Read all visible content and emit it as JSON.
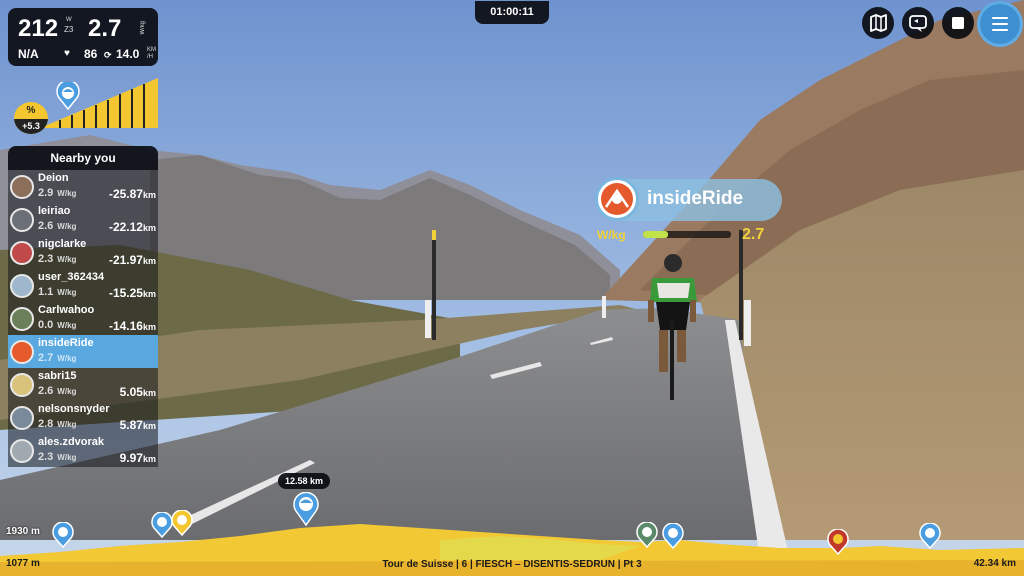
{
  "stats": {
    "power": "212",
    "power_unit": "W",
    "zone": "Z3",
    "wkg": "2.7",
    "wkg_unit": "W/kg",
    "heart_rate": "N/A",
    "cadence": "86",
    "speed": "14.0",
    "speed_unit_top": "KM",
    "speed_unit_bot": "/H"
  },
  "grade": {
    "label": "%",
    "value": "+5.3"
  },
  "timer": "01:00:11",
  "nearby": {
    "title": "Nearby you",
    "wkg_unit": "W/kg",
    "dist_unit": "km",
    "riders": [
      {
        "name": "Deion",
        "wkg": "2.9",
        "dist": "-25.87",
        "active": false
      },
      {
        "name": "leiriao",
        "wkg": "2.6",
        "dist": "-22.12",
        "active": false
      },
      {
        "name": "nigclarke",
        "wkg": "2.3",
        "dist": "-21.97",
        "active": false
      },
      {
        "name": "user_362434",
        "wkg": "1.1",
        "dist": "-15.25",
        "active": false
      },
      {
        "name": "Carlwahoo",
        "wkg": "0.0",
        "dist": "-14.16",
        "active": false
      },
      {
        "name": "insideRide",
        "wkg": "2.7",
        "dist": "",
        "active": true
      },
      {
        "name": "sabri15",
        "wkg": "2.6",
        "dist": "5.05",
        "active": false
      },
      {
        "name": "nelsonsnyder",
        "wkg": "2.8",
        "dist": "5.87",
        "active": false
      },
      {
        "name": "ales.zdvorak",
        "wkg": "2.3",
        "dist": "9.97",
        "active": false
      }
    ]
  },
  "rider_tag": {
    "name": "insideRide",
    "wkg_label": "W/kg",
    "wkg_value": "2.7",
    "wkg_fraction": 0.28
  },
  "elevation": {
    "max": "1930 m",
    "min": "1077 m",
    "current_distance": "12.58 km",
    "total_distance": "42.34 km",
    "route_name": "Tour de Suisse | 6 | FIESCH – DISENTIS-SEDRUN | Pt 3"
  },
  "colors": {
    "accent_blue": "#3c8fd0",
    "panel_bg": "#0a0c12",
    "highlight_yellow": "#f4c62f",
    "active_row": "#5aa8e0"
  }
}
